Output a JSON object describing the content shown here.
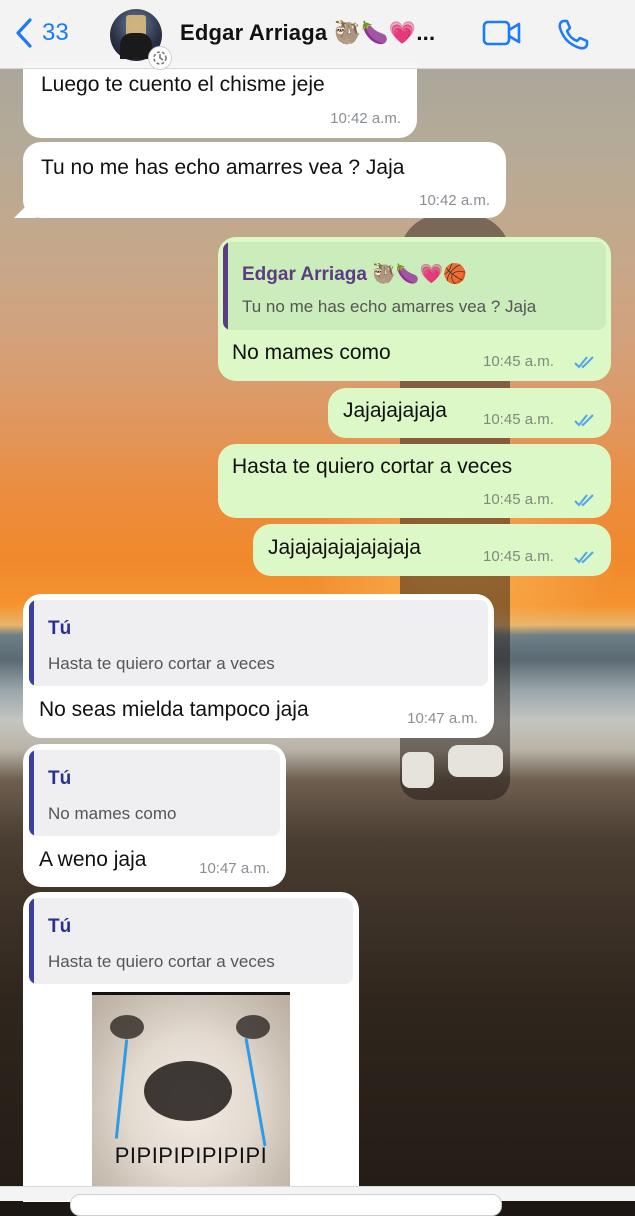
{
  "header": {
    "back_count": "33",
    "contact_name": "Edgar Arriaga 🦥🍆💗...",
    "accent_color": "#1a7cf7",
    "icons": [
      "chevron-left-icon",
      "video-call-icon",
      "phone-icon",
      "timer-icon"
    ]
  },
  "messages": [
    {
      "direction": "in",
      "text": "Luego te cuento el chisme jeje",
      "time": "10:42 a.m."
    },
    {
      "direction": "in",
      "text": "Tu no me has echo amarres vea ? Jaja",
      "time": "10:42 a.m."
    },
    {
      "direction": "out",
      "quote_name": "Edgar Arriaga 🦥🍆💗🏀",
      "quote_text": "Tu no me has echo amarres vea ? Jaja",
      "text": "No mames como",
      "time": "10:45 a.m.",
      "status": "read"
    },
    {
      "direction": "out",
      "text": "Jajajajajaja",
      "time": "10:45 a.m.",
      "status": "read"
    },
    {
      "direction": "out",
      "text": "Hasta te quiero cortar a veces",
      "time": "10:45 a.m.",
      "status": "read"
    },
    {
      "direction": "out",
      "text": "Jajajajajajajajaja",
      "time": "10:45 a.m.",
      "status": "read"
    },
    {
      "direction": "in",
      "quote_name": "Tú",
      "quote_text": "Hasta te quiero cortar a veces",
      "text": "No seas mielda tampoco jaja",
      "time": "10:47 a.m."
    },
    {
      "direction": "in",
      "quote_name": "Tú",
      "quote_text": "No mames como",
      "text": "A weno jaja",
      "time": "10:47 a.m."
    },
    {
      "direction": "in",
      "quote_name": "Tú",
      "quote_text": "Hasta te quiero cortar a veces",
      "sticker_caption": "PIPIPIPIPIPIPI"
    }
  ],
  "colors": {
    "incoming_bubble": "#ffffff",
    "outgoing_bubble": "#dcf8c6",
    "read_tick": "#4fa7e8"
  }
}
